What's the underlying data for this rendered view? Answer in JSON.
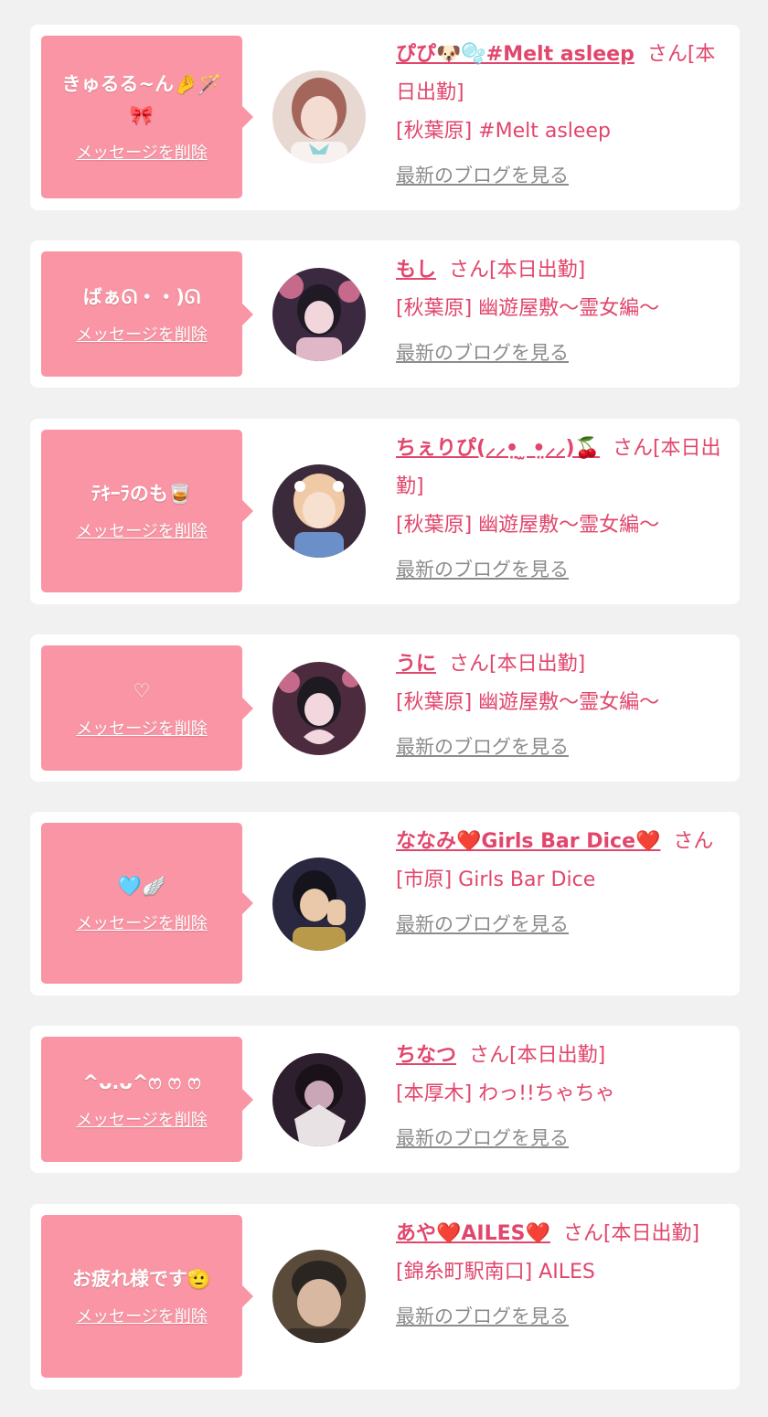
{
  "delete_label": "メッセージを削除",
  "blog_label": "最新のブログを見る",
  "colors": {
    "accent": "#e1466c",
    "bubble": "#f995a4",
    "background": "#f1f1f1",
    "link_gray": "#8c8c8c"
  },
  "cards": [
    {
      "message": "きゅるる~ん🤌🪄🎀",
      "name": "ぴぴ🐶🫧#Melt asleep",
      "suffix": "さん[本日出勤]",
      "shop": "[秋葉原] #Melt asleep",
      "avatar_colors": [
        "#d9a59a",
        "#f1dcd6",
        "#8fd3d6"
      ]
    },
    {
      "message": "ばぁᘏ・・)ᘏ",
      "name": "もし",
      "suffix": "さん[本日出勤]",
      "shop": "[秋葉原] 幽遊屋敷〜霊女編〜",
      "avatar_colors": [
        "#3b2940",
        "#e0b7c6",
        "#1f1a24"
      ]
    },
    {
      "message": "ﾃｷｰﾗのも🥃",
      "name": "ちぇりぴ(⸝⸝•̤ ̫ •̤⸝⸝)🍒",
      "suffix": "さん[本日出勤]",
      "shop": "[秋葉原] 幽遊屋敷〜霊女編〜",
      "avatar_colors": [
        "#f0c9a6",
        "#6a8fc9",
        "#3a2a3a"
      ]
    },
    {
      "message": "♡",
      "name": "うに",
      "suffix": "さん[本日出勤]",
      "shop": "[秋葉原] 幽遊屋敷〜霊女編〜",
      "avatar_colors": [
        "#4c2b3f",
        "#f2d8de",
        "#1d1a22"
      ]
    },
    {
      "message": "🩵🪽",
      "name": "ななみ❤️Girls Bar Dice❤️",
      "suffix": "さん",
      "shop": "[市原] Girls Bar Dice",
      "avatar_colors": [
        "#2a2840",
        "#e9c9a9",
        "#b99a4a"
      ]
    },
    {
      "message": "^ᴗ.ᴗ^ෆ ෆ ෆ",
      "name": "ちなつ",
      "suffix": "さん[本日出勤]",
      "shop": "[本厚木] わっ!!ちゃちゃ",
      "avatar_colors": [
        "#2d1f2d",
        "#c9b7c9",
        "#8a6a7a"
      ]
    },
    {
      "message": "お疲れ様です🫡",
      "name": "あや❤️AILES❤️",
      "suffix": "さん[本日出勤]",
      "shop": "[錦糸町駅南口] AILES",
      "avatar_colors": [
        "#5a4a3a",
        "#d8b8a0",
        "#2a2520"
      ]
    }
  ]
}
